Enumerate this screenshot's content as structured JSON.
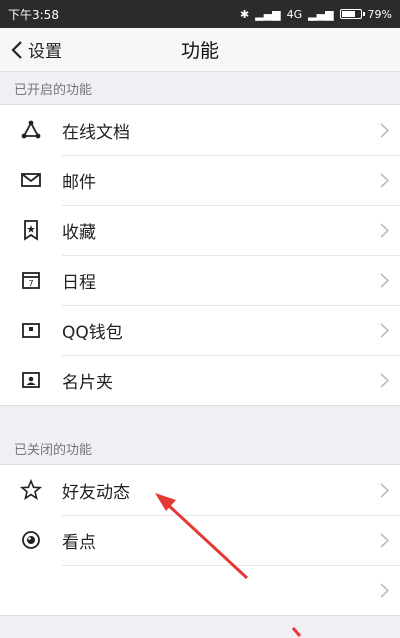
{
  "status": {
    "time": "下午3:58",
    "network": "4G",
    "battery": "79%",
    "battery_level": 0.79
  },
  "nav": {
    "back_label": "设置",
    "title": "功能"
  },
  "enabled_section": {
    "header": "已开启的功能",
    "items": [
      {
        "label": "在线文档",
        "icon": "online-doc-icon"
      },
      {
        "label": "邮件",
        "icon": "mail-icon"
      },
      {
        "label": "收藏",
        "icon": "bookmark-icon"
      },
      {
        "label": "日程",
        "icon": "calendar-icon"
      },
      {
        "label": "QQ钱包",
        "icon": "wallet-icon"
      },
      {
        "label": "名片夹",
        "icon": "card-icon"
      }
    ]
  },
  "disabled_section": {
    "header": "已关闭的功能",
    "items": [
      {
        "label": "好友动态",
        "icon": "star-icon"
      },
      {
        "label": "看点",
        "icon": "eye-icon"
      }
    ]
  }
}
